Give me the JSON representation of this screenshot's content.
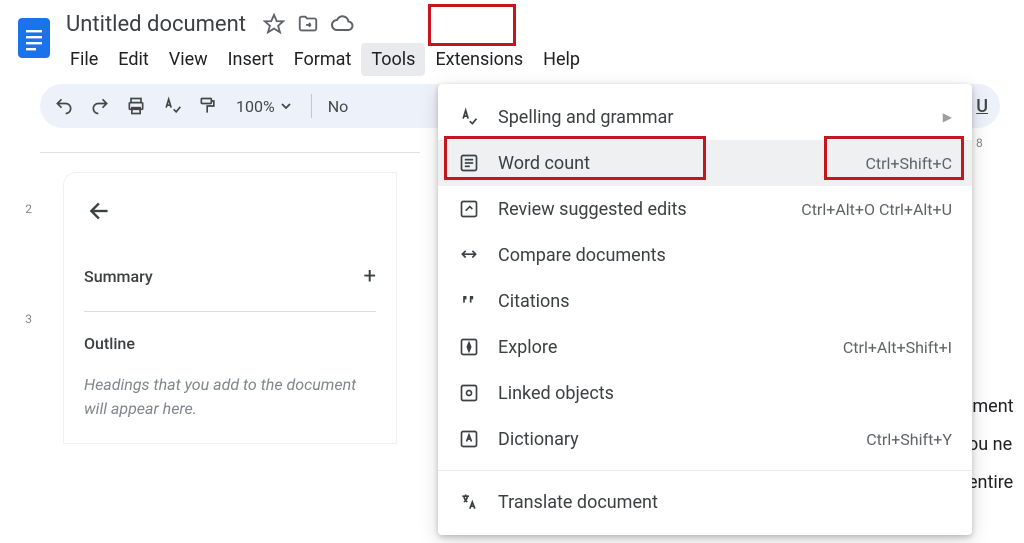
{
  "header": {
    "title": "Untitled document",
    "icons": {
      "star": "star-icon",
      "move": "move-to-folder-icon",
      "cloud": "cloud-status-icon"
    }
  },
  "menubar": {
    "items": [
      {
        "label": "File"
      },
      {
        "label": "Edit"
      },
      {
        "label": "View"
      },
      {
        "label": "Insert"
      },
      {
        "label": "Format"
      },
      {
        "label": "Tools",
        "active": true
      },
      {
        "label": "Extensions"
      },
      {
        "label": "Help"
      }
    ]
  },
  "toolbar": {
    "zoom": "100%",
    "style_text_fragment": "No",
    "underline_glyph": "U"
  },
  "left_panel": {
    "summary_label": "Summary",
    "outline_label": "Outline",
    "outline_hint": "Headings that you add to the document will appear here."
  },
  "dropdown": {
    "items": [
      {
        "icon": "spellcheck-icon",
        "label": "Spelling and grammar",
        "submenu": true
      },
      {
        "icon": "word-count-icon",
        "label": "Word count",
        "shortcut": "Ctrl+Shift+C",
        "highlight": true
      },
      {
        "icon": "review-edits-icon",
        "label": "Review suggested edits",
        "shortcut": "Ctrl+Alt+O Ctrl+Alt+U"
      },
      {
        "icon": "compare-icon",
        "label": "Compare documents"
      },
      {
        "icon": "citations-icon",
        "label": "Citations"
      },
      {
        "icon": "explore-icon",
        "label": "Explore",
        "shortcut": "Ctrl+Alt+Shift+I"
      },
      {
        "icon": "linked-objects-icon",
        "label": "Linked objects"
      },
      {
        "icon": "dictionary-icon",
        "label": "Dictionary",
        "shortcut": "Ctrl+Shift+Y"
      }
    ],
    "below_separator": [
      {
        "icon": "translate-icon",
        "label": "Translate document"
      }
    ]
  },
  "ruler": {
    "v_ticks": [
      "2",
      "3"
    ],
    "h_ticks": [
      "8"
    ]
  },
  "doc_body_fragments": [
    "iment",
    "ou ne",
    "entire"
  ]
}
